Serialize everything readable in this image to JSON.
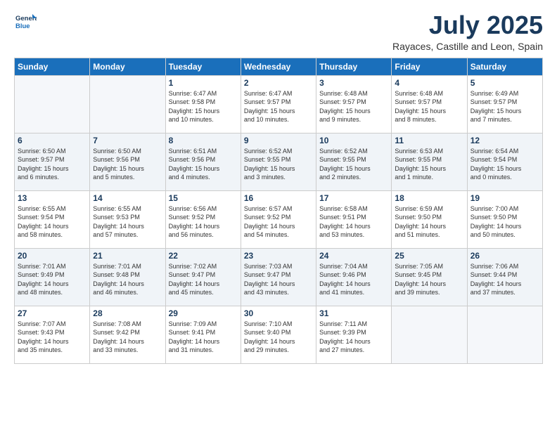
{
  "logo": {
    "line1": "General",
    "line2": "Blue"
  },
  "title": "July 2025",
  "location": "Rayaces, Castille and Leon, Spain",
  "days_of_week": [
    "Sunday",
    "Monday",
    "Tuesday",
    "Wednesday",
    "Thursday",
    "Friday",
    "Saturday"
  ],
  "weeks": [
    [
      {
        "day": "",
        "info": ""
      },
      {
        "day": "",
        "info": ""
      },
      {
        "day": "1",
        "info": "Sunrise: 6:47 AM\nSunset: 9:58 PM\nDaylight: 15 hours\nand 10 minutes."
      },
      {
        "day": "2",
        "info": "Sunrise: 6:47 AM\nSunset: 9:57 PM\nDaylight: 15 hours\nand 10 minutes."
      },
      {
        "day": "3",
        "info": "Sunrise: 6:48 AM\nSunset: 9:57 PM\nDaylight: 15 hours\nand 9 minutes."
      },
      {
        "day": "4",
        "info": "Sunrise: 6:48 AM\nSunset: 9:57 PM\nDaylight: 15 hours\nand 8 minutes."
      },
      {
        "day": "5",
        "info": "Sunrise: 6:49 AM\nSunset: 9:57 PM\nDaylight: 15 hours\nand 7 minutes."
      }
    ],
    [
      {
        "day": "6",
        "info": "Sunrise: 6:50 AM\nSunset: 9:57 PM\nDaylight: 15 hours\nand 6 minutes."
      },
      {
        "day": "7",
        "info": "Sunrise: 6:50 AM\nSunset: 9:56 PM\nDaylight: 15 hours\nand 5 minutes."
      },
      {
        "day": "8",
        "info": "Sunrise: 6:51 AM\nSunset: 9:56 PM\nDaylight: 15 hours\nand 4 minutes."
      },
      {
        "day": "9",
        "info": "Sunrise: 6:52 AM\nSunset: 9:55 PM\nDaylight: 15 hours\nand 3 minutes."
      },
      {
        "day": "10",
        "info": "Sunrise: 6:52 AM\nSunset: 9:55 PM\nDaylight: 15 hours\nand 2 minutes."
      },
      {
        "day": "11",
        "info": "Sunrise: 6:53 AM\nSunset: 9:55 PM\nDaylight: 15 hours\nand 1 minute."
      },
      {
        "day": "12",
        "info": "Sunrise: 6:54 AM\nSunset: 9:54 PM\nDaylight: 15 hours\nand 0 minutes."
      }
    ],
    [
      {
        "day": "13",
        "info": "Sunrise: 6:55 AM\nSunset: 9:54 PM\nDaylight: 14 hours\nand 58 minutes."
      },
      {
        "day": "14",
        "info": "Sunrise: 6:55 AM\nSunset: 9:53 PM\nDaylight: 14 hours\nand 57 minutes."
      },
      {
        "day": "15",
        "info": "Sunrise: 6:56 AM\nSunset: 9:52 PM\nDaylight: 14 hours\nand 56 minutes."
      },
      {
        "day": "16",
        "info": "Sunrise: 6:57 AM\nSunset: 9:52 PM\nDaylight: 14 hours\nand 54 minutes."
      },
      {
        "day": "17",
        "info": "Sunrise: 6:58 AM\nSunset: 9:51 PM\nDaylight: 14 hours\nand 53 minutes."
      },
      {
        "day": "18",
        "info": "Sunrise: 6:59 AM\nSunset: 9:50 PM\nDaylight: 14 hours\nand 51 minutes."
      },
      {
        "day": "19",
        "info": "Sunrise: 7:00 AM\nSunset: 9:50 PM\nDaylight: 14 hours\nand 50 minutes."
      }
    ],
    [
      {
        "day": "20",
        "info": "Sunrise: 7:01 AM\nSunset: 9:49 PM\nDaylight: 14 hours\nand 48 minutes."
      },
      {
        "day": "21",
        "info": "Sunrise: 7:01 AM\nSunset: 9:48 PM\nDaylight: 14 hours\nand 46 minutes."
      },
      {
        "day": "22",
        "info": "Sunrise: 7:02 AM\nSunset: 9:47 PM\nDaylight: 14 hours\nand 45 minutes."
      },
      {
        "day": "23",
        "info": "Sunrise: 7:03 AM\nSunset: 9:47 PM\nDaylight: 14 hours\nand 43 minutes."
      },
      {
        "day": "24",
        "info": "Sunrise: 7:04 AM\nSunset: 9:46 PM\nDaylight: 14 hours\nand 41 minutes."
      },
      {
        "day": "25",
        "info": "Sunrise: 7:05 AM\nSunset: 9:45 PM\nDaylight: 14 hours\nand 39 minutes."
      },
      {
        "day": "26",
        "info": "Sunrise: 7:06 AM\nSunset: 9:44 PM\nDaylight: 14 hours\nand 37 minutes."
      }
    ],
    [
      {
        "day": "27",
        "info": "Sunrise: 7:07 AM\nSunset: 9:43 PM\nDaylight: 14 hours\nand 35 minutes."
      },
      {
        "day": "28",
        "info": "Sunrise: 7:08 AM\nSunset: 9:42 PM\nDaylight: 14 hours\nand 33 minutes."
      },
      {
        "day": "29",
        "info": "Sunrise: 7:09 AM\nSunset: 9:41 PM\nDaylight: 14 hours\nand 31 minutes."
      },
      {
        "day": "30",
        "info": "Sunrise: 7:10 AM\nSunset: 9:40 PM\nDaylight: 14 hours\nand 29 minutes."
      },
      {
        "day": "31",
        "info": "Sunrise: 7:11 AM\nSunset: 9:39 PM\nDaylight: 14 hours\nand 27 minutes."
      },
      {
        "day": "",
        "info": ""
      },
      {
        "day": "",
        "info": ""
      }
    ]
  ]
}
